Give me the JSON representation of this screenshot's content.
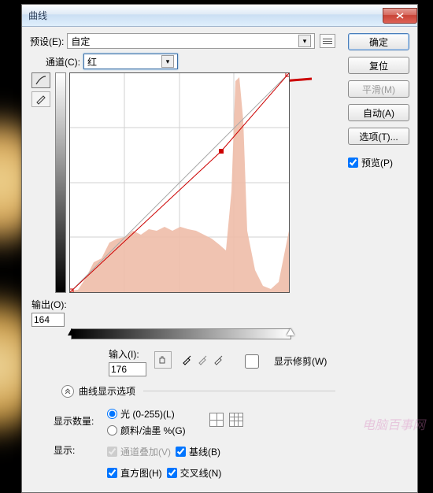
{
  "title": "曲线",
  "preset": {
    "label": "预设(E):",
    "value": "自定"
  },
  "channel": {
    "label": "通道(C):",
    "value": "红"
  },
  "output": {
    "label": "输出(O):",
    "value": "164"
  },
  "input": {
    "label": "输入(I):",
    "value": "176"
  },
  "show_clipping": "显示修剪(W)",
  "expand_label": "曲线显示选项",
  "display_amount": {
    "label": "显示数量:",
    "opt1": "光 (0-255)(L)",
    "opt2": "颜料/油墨 %(G)"
  },
  "show": {
    "label": "显示:",
    "channel_overlay": "通道叠加(V)",
    "histogram": "直方图(H)",
    "baseline": "基线(B)",
    "intersection": "交叉线(N)"
  },
  "buttons": {
    "ok": "确定",
    "reset": "复位",
    "smooth": "平滑(M)",
    "auto": "自动(A)",
    "options": "选项(T)..."
  },
  "preview": "预览(P)",
  "chart_data": {
    "type": "curve",
    "title": "",
    "xlabel": "输入",
    "ylabel": "输出",
    "xlim": [
      0,
      255
    ],
    "ylim": [
      0,
      255
    ],
    "points": [
      {
        "in": 0,
        "out": 0
      },
      {
        "in": 176,
        "out": 164
      },
      {
        "in": 255,
        "out": 255
      }
    ],
    "baseline": [
      [
        0,
        0
      ],
      [
        255,
        255
      ]
    ],
    "histogram_peaks": "large spike near 200-215, moderate mass 40-180, small tail near 255"
  }
}
